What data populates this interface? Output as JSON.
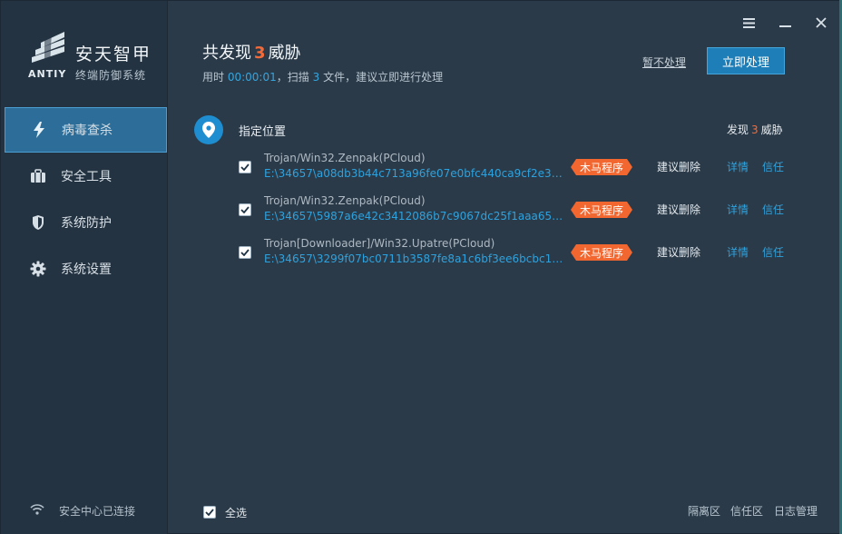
{
  "brand": {
    "logo_text": "ANTIY",
    "title": "安天智甲",
    "subtitle": "终端防御系统"
  },
  "window_controls": {
    "menu_icon": "menu-icon",
    "minimize_icon": "minimize-icon",
    "close_icon": "close-icon"
  },
  "sidebar": {
    "items": [
      {
        "label": "病毒查杀",
        "icon": "lightning-icon",
        "active": true
      },
      {
        "label": "安全工具",
        "icon": "briefcase-icon",
        "active": false
      },
      {
        "label": "系统防护",
        "icon": "shield-icon",
        "active": false
      },
      {
        "label": "系统设置",
        "icon": "gear-icon",
        "active": false
      }
    ],
    "status": "安全中心已连接"
  },
  "header": {
    "prefix": "共发现",
    "count": "3",
    "suffix": "威胁",
    "time_label": "用时",
    "time_value": "00:00:01",
    "scan_label": "，扫描",
    "scan_count": "3",
    "scan_suffix": "文件，建议立即进行处理",
    "ignore_link": "暂不处理",
    "handle_button": "立即处理"
  },
  "location": {
    "title": "指定位置",
    "found_prefix": "发现",
    "found_count": "3",
    "found_suffix": "威胁"
  },
  "threats": [
    {
      "name": "Trojan/Win32.Zenpak(PCloud)",
      "path": "E:\\34657\\a08db3b44c713a96fe07e0bfc440ca9cf2e3d ...",
      "tag": "木马程序",
      "suggestion": "建议删除",
      "detail": "详情",
      "trust": "信任",
      "checked": true
    },
    {
      "name": "Trojan/Win32.Zenpak(PCloud)",
      "path": "E:\\34657\\5987a6e42c3412086b7c9067dc25f1aaa659 ...",
      "tag": "木马程序",
      "suggestion": "建议删除",
      "detail": "详情",
      "trust": "信任",
      "checked": true
    },
    {
      "name": "Trojan[Downloader]/Win32.Upatre(PCloud)",
      "path": "E:\\34657\\3299f07bc0711b3587fe8a1c6bf3ee6bcbc14 ...",
      "tag": "木马程序",
      "suggestion": "建议删除",
      "detail": "详情",
      "trust": "信任",
      "checked": true
    }
  ],
  "footer": {
    "select_all": "全选",
    "quarantine": "隔离区",
    "trust_zone": "信任区",
    "log": "日志管理"
  },
  "colors": {
    "accent": "#1e7fb8",
    "threat_orange": "#f2672f",
    "link_blue": "#2ea2de"
  }
}
